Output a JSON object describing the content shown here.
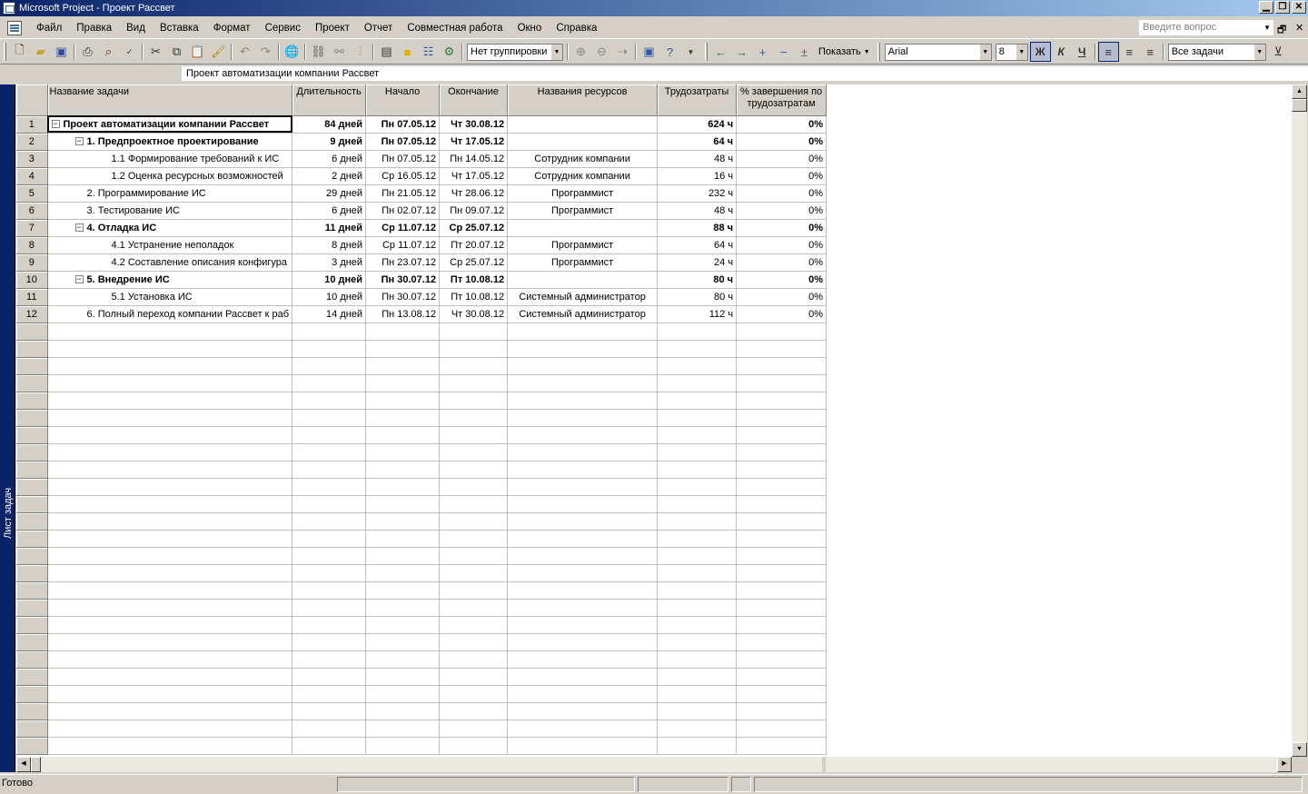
{
  "window": {
    "title": "Microsoft Project - Проект Рассвет",
    "buttons": {
      "minimize": "▁",
      "restore": "❐",
      "close": "✕"
    }
  },
  "menu": {
    "items": [
      "Файл",
      "Правка",
      "Вид",
      "Вставка",
      "Формат",
      "Сервис",
      "Проект",
      "Отчет",
      "Совместная работа",
      "Окно",
      "Справка"
    ],
    "question_placeholder": "Введите вопрос",
    "doc_restore": "🗗",
    "doc_close": "✕"
  },
  "toolbar": {
    "group_combo": "Нет группировки",
    "show_label": "Показать",
    "font": "Arial",
    "font_size": "8",
    "bold": "Ж",
    "italic": "К",
    "underline": "Ч",
    "filter_combo": "Все задачи"
  },
  "entry_bar": {
    "value": "Проект автоматизации компании Рассвет"
  },
  "view_bar": {
    "label": "Лист задач"
  },
  "table": {
    "columns": [
      "Название задачи",
      "Длительность",
      "Начало",
      "Окончание",
      "Названия ресурсов",
      "Трудозатраты",
      "% завершения по трудозатратам"
    ],
    "rows": [
      {
        "id": "1",
        "name": "Проект автоматизации компании Рассвет",
        "duration": "84 дней",
        "start": "Пн 07.05.12",
        "finish": "Чт 30.08.12",
        "resource": "",
        "work": "624 ч",
        "pct": "0%"
      },
      {
        "id": "2",
        "name": "1. Предпроектное проектирование",
        "duration": "9 дней",
        "start": "Пн 07.05.12",
        "finish": "Чт 17.05.12",
        "resource": "",
        "work": "64 ч",
        "pct": "0%"
      },
      {
        "id": "3",
        "name": "1.1 Формирование требований к ИС",
        "duration": "6 дней",
        "start": "Пн 07.05.12",
        "finish": "Пн 14.05.12",
        "resource": "Сотрудник компании",
        "work": "48 ч",
        "pct": "0%"
      },
      {
        "id": "4",
        "name": "1.2 Оценка ресурсных возможностей",
        "duration": "2 дней",
        "start": "Ср 16.05.12",
        "finish": "Чт 17.05.12",
        "resource": "Сотрудник компании",
        "work": "16 ч",
        "pct": "0%"
      },
      {
        "id": "5",
        "name": "2. Программирование ИС",
        "duration": "29 дней",
        "start": "Пн 21.05.12",
        "finish": "Чт 28.06.12",
        "resource": "Программист",
        "work": "232 ч",
        "pct": "0%"
      },
      {
        "id": "6",
        "name": "3. Тестирование ИС",
        "duration": "6 дней",
        "start": "Пн 02.07.12",
        "finish": "Пн 09.07.12",
        "resource": "Программист",
        "work": "48 ч",
        "pct": "0%"
      },
      {
        "id": "7",
        "name": "4. Отладка ИС",
        "duration": "11 дней",
        "start": "Ср 11.07.12",
        "finish": "Ср 25.07.12",
        "resource": "",
        "work": "88 ч",
        "pct": "0%"
      },
      {
        "id": "8",
        "name": "4.1 Устранение неполадок",
        "duration": "8 дней",
        "start": "Ср 11.07.12",
        "finish": "Пт 20.07.12",
        "resource": "Программист",
        "work": "64 ч",
        "pct": "0%"
      },
      {
        "id": "9",
        "name": "4.2 Составление описания конфигура",
        "duration": "3 дней",
        "start": "Пн 23.07.12",
        "finish": "Ср 25.07.12",
        "resource": "Программист",
        "work": "24 ч",
        "pct": "0%"
      },
      {
        "id": "10",
        "name": "5. Внедрение ИС",
        "duration": "10 дней",
        "start": "Пн 30.07.12",
        "finish": "Пт 10.08.12",
        "resource": "",
        "work": "80 ч",
        "pct": "0%"
      },
      {
        "id": "11",
        "name": "5.1 Установка ИС",
        "duration": "10 дней",
        "start": "Пн 30.07.12",
        "finish": "Пт 10.08.12",
        "resource": "Системный администратор",
        "work": "80 ч",
        "pct": "0%"
      },
      {
        "id": "12",
        "name": "6. Полный переход компании Рассвет к раб",
        "duration": "14 дней",
        "start": "Пн 13.08.12",
        "finish": "Чт 30.08.12",
        "resource": "Системный администратор",
        "work": "112 ч",
        "pct": "0%"
      }
    ]
  },
  "status": {
    "text": "Готово"
  }
}
